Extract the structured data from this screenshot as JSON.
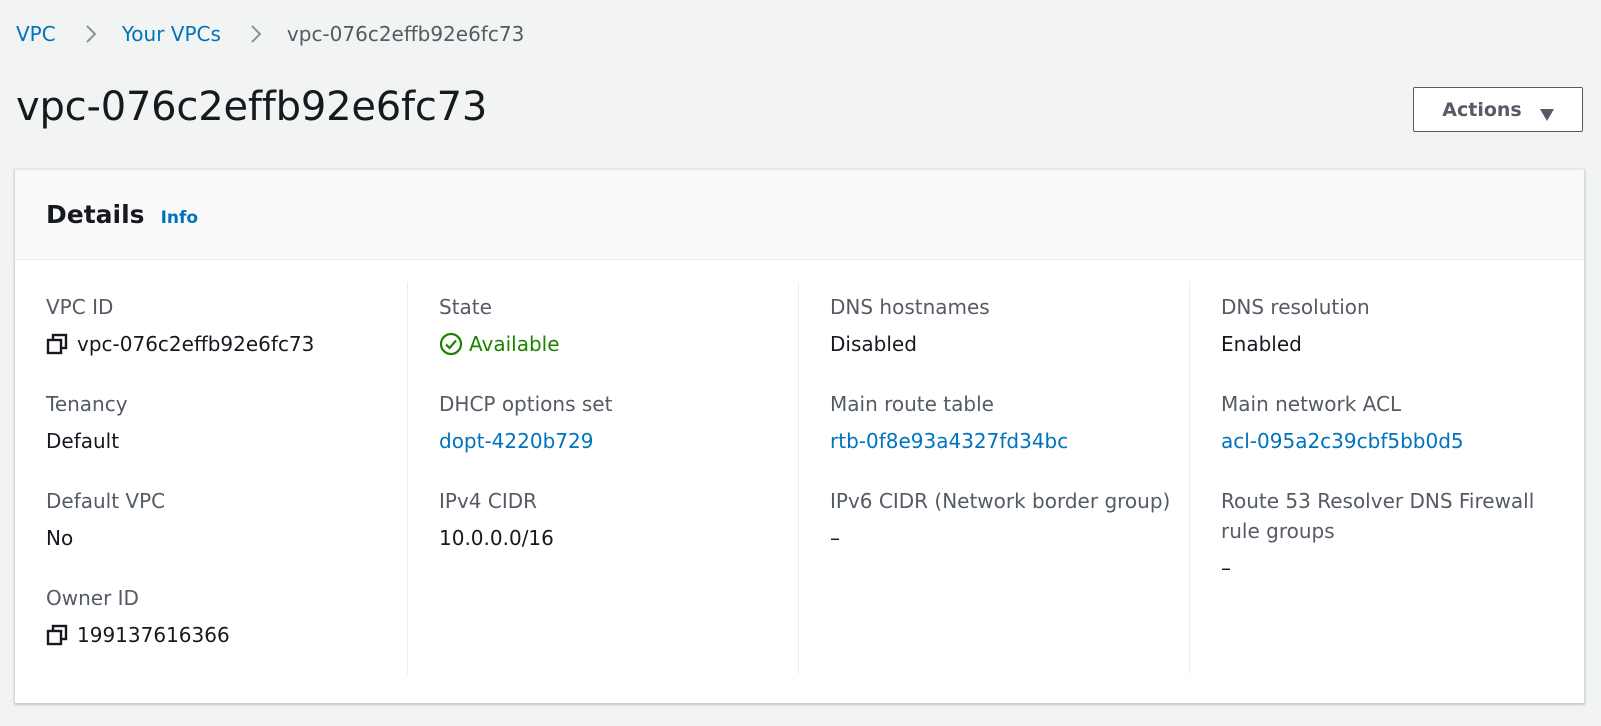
{
  "breadcrumb": {
    "items": [
      "VPC",
      "Your VPCs",
      "vpc-076c2effb92e6fc73"
    ]
  },
  "header": {
    "title": "vpc-076c2effb92e6fc73",
    "actions_label": "Actions"
  },
  "details": {
    "title": "Details",
    "info_label": "Info",
    "fields": {
      "vpc_id": {
        "label": "VPC ID",
        "value": "vpc-076c2effb92e6fc73",
        "icon": "copy-icon"
      },
      "tenancy": {
        "label": "Tenancy",
        "value": "Default"
      },
      "default_vpc": {
        "label": "Default VPC",
        "value": "No"
      },
      "owner_id": {
        "label": "Owner ID",
        "value": "199137616366",
        "icon": "copy-icon"
      },
      "state": {
        "label": "State",
        "value": "Available",
        "icon": "check-circle-icon"
      },
      "dhcp_options_set": {
        "label": "DHCP options set",
        "value": "dopt-4220b729"
      },
      "ipv4_cidr": {
        "label": "IPv4 CIDR",
        "value": "10.0.0.0/16"
      },
      "dns_hostnames": {
        "label": "DNS hostnames",
        "value": "Disabled"
      },
      "main_route_table": {
        "label": "Main route table",
        "value": "rtb-0f8e93a4327fd34bc"
      },
      "ipv6_cidr": {
        "label": "IPv6 CIDR (Network border group)",
        "value": "–"
      },
      "dns_resolution": {
        "label": "DNS resolution",
        "value": "Enabled"
      },
      "main_network_acl": {
        "label": "Main network ACL",
        "value": "acl-095a2c39cbf5bb0d5"
      },
      "route53_firewall": {
        "label": "Route 53 Resolver DNS Firewall rule groups",
        "value": "–"
      }
    }
  },
  "colors": {
    "link": "#0073bb",
    "success": "#1d8102",
    "label": "#545b64",
    "text": "#16191f",
    "background": "#f2f3f3"
  }
}
